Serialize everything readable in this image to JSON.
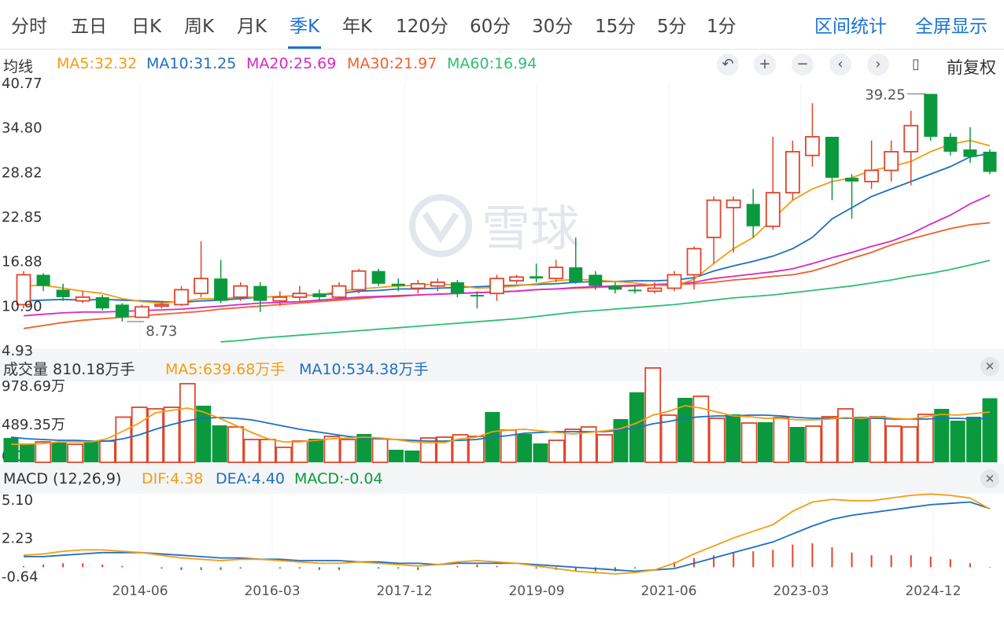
{
  "periods": [
    "分时",
    "五日",
    "日K",
    "周K",
    "月K",
    "季K",
    "年K",
    "120分",
    "60分",
    "30分",
    "15分",
    "5分",
    "1分"
  ],
  "active_period": "季K",
  "tools": {
    "range_stats": "区间统计",
    "fullscreen": "全屏显示"
  },
  "ma_bar": {
    "title": "均线",
    "items": [
      {
        "text": "MA5:32.32",
        "color": "#f39c12"
      },
      {
        "text": "MA10:31.25",
        "color": "#1f6fc1"
      },
      {
        "text": "MA20:25.69",
        "color": "#d62ac6"
      },
      {
        "text": "MA30:21.97",
        "color": "#f0612c"
      },
      {
        "text": "MA60:16.94",
        "color": "#2fbf71"
      }
    ],
    "adjust": "前复权"
  },
  "controls": [
    "undo-icon",
    "plus-icon",
    "minus-icon",
    "chevron-left-icon",
    "chevron-right-icon",
    "candle-icon"
  ],
  "watermark": "雪球",
  "volume_bar": {
    "title": "成交量 810.18万手",
    "ma5": "MA5:639.68万手",
    "ma10": "MA10:534.38万手"
  },
  "macd_bar": {
    "title": "MACD (12,26,9)",
    "dif": "DIF:4.38",
    "dea": "DEA:4.40",
    "macd": "MACD:-0.04"
  },
  "colors": {
    "up": "#e0452a",
    "down": "#0a9a3d",
    "ma5": "#f39c12",
    "ma10": "#1f6fc1",
    "ma20": "#d62ac6",
    "ma30": "#f0612c",
    "ma60": "#2fbf71",
    "dif": "#f39c12",
    "dea": "#1f6fc1"
  },
  "chart_data": {
    "type": "candlestick",
    "x_ticks": [
      "2014-06",
      "2016-03",
      "2017-12",
      "2019-09",
      "2021-06",
      "2023-03",
      "2024-12"
    ],
    "price_axis": {
      "ticks": [
        "40.77",
        "34.80",
        "28.82",
        "22.85",
        "16.88",
        "10.90",
        "4.93"
      ]
    },
    "annotations": {
      "high": "39.25",
      "low": "8.73"
    },
    "candles": [
      {
        "o": 11.0,
        "c": 15.0,
        "h": 15.5,
        "l": 10.5
      },
      {
        "o": 15.0,
        "c": 13.5,
        "h": 15.2,
        "l": 12.8
      },
      {
        "o": 13.0,
        "c": 12.0,
        "h": 13.8,
        "l": 11.5
      },
      {
        "o": 11.5,
        "c": 12.0,
        "h": 12.8,
        "l": 11.2
      },
      {
        "o": 12.0,
        "c": 10.5,
        "h": 12.3,
        "l": 10.2
      },
      {
        "o": 11.0,
        "c": 9.3,
        "h": 11.2,
        "l": 8.73
      },
      {
        "o": 9.3,
        "c": 10.7,
        "h": 11.0,
        "l": 9.2
      },
      {
        "o": 10.8,
        "c": 11.0,
        "h": 11.5,
        "l": 10.5
      },
      {
        "o": 11.0,
        "c": 13.0,
        "h": 13.5,
        "l": 10.8
      },
      {
        "o": 12.5,
        "c": 14.5,
        "h": 19.5,
        "l": 12.0
      },
      {
        "o": 14.5,
        "c": 11.5,
        "h": 17.0,
        "l": 11.2
      },
      {
        "o": 12.0,
        "c": 13.5,
        "h": 14.0,
        "l": 11.5
      },
      {
        "o": 13.5,
        "c": 11.5,
        "h": 14.0,
        "l": 10.0
      },
      {
        "o": 11.5,
        "c": 12.0,
        "h": 12.8,
        "l": 10.8
      },
      {
        "o": 12.0,
        "c": 12.5,
        "h": 13.5,
        "l": 11.5
      },
      {
        "o": 12.5,
        "c": 12.0,
        "h": 13.0,
        "l": 11.5
      },
      {
        "o": 12.0,
        "c": 13.5,
        "h": 14.0,
        "l": 11.8
      },
      {
        "o": 13.0,
        "c": 15.5,
        "h": 15.8,
        "l": 12.5
      },
      {
        "o": 15.5,
        "c": 13.8,
        "h": 15.8,
        "l": 13.5
      },
      {
        "o": 13.8,
        "c": 13.5,
        "h": 14.5,
        "l": 12.8
      },
      {
        "o": 13.2,
        "c": 13.8,
        "h": 14.3,
        "l": 12.5
      },
      {
        "o": 13.5,
        "c": 14.0,
        "h": 14.5,
        "l": 12.8
      },
      {
        "o": 14.0,
        "c": 12.5,
        "h": 14.3,
        "l": 12.0
      },
      {
        "o": 12.3,
        "c": 12.2,
        "h": 12.8,
        "l": 10.5
      },
      {
        "o": 12.5,
        "c": 14.5,
        "h": 15.0,
        "l": 11.5
      },
      {
        "o": 14.2,
        "c": 14.7,
        "h": 15.0,
        "l": 13.8
      },
      {
        "o": 14.8,
        "c": 14.5,
        "h": 16.5,
        "l": 14.0
      },
      {
        "o": 14.5,
        "c": 16.0,
        "h": 17.0,
        "l": 14.0
      },
      {
        "o": 16.0,
        "c": 14.0,
        "h": 20.0,
        "l": 13.8
      },
      {
        "o": 15.0,
        "c": 13.5,
        "h": 15.5,
        "l": 13.0
      },
      {
        "o": 13.5,
        "c": 13.0,
        "h": 14.0,
        "l": 12.5
      },
      {
        "o": 13.0,
        "c": 12.8,
        "h": 13.5,
        "l": 12.5
      },
      {
        "o": 12.8,
        "c": 13.2,
        "h": 14.0,
        "l": 12.5
      },
      {
        "o": 13.2,
        "c": 15.0,
        "h": 15.5,
        "l": 12.8
      },
      {
        "o": 15.0,
        "c": 18.5,
        "h": 18.8,
        "l": 13.0
      },
      {
        "o": 20.0,
        "c": 25.0,
        "h": 25.5,
        "l": 16.5
      },
      {
        "o": 24.0,
        "c": 25.0,
        "h": 25.5,
        "l": 18.0
      },
      {
        "o": 24.5,
        "c": 21.5,
        "h": 26.5,
        "l": 20.0
      },
      {
        "o": 21.5,
        "c": 26.0,
        "h": 33.5,
        "l": 21.0
      },
      {
        "o": 26.0,
        "c": 31.5,
        "h": 33.0,
        "l": 25.0
      },
      {
        "o": 31.0,
        "c": 33.5,
        "h": 38.0,
        "l": 29.5
      },
      {
        "o": 33.5,
        "c": 28.0,
        "h": 33.5,
        "l": 25.0
      },
      {
        "o": 28.0,
        "c": 27.5,
        "h": 28.5,
        "l": 22.5
      },
      {
        "o": 27.5,
        "c": 29.0,
        "h": 33.0,
        "l": 26.5
      },
      {
        "o": 29.0,
        "c": 31.5,
        "h": 33.0,
        "l": 27.5
      },
      {
        "o": 31.5,
        "c": 35.0,
        "h": 37.0,
        "l": 27.0
      },
      {
        "o": 39.25,
        "c": 33.5,
        "h": 39.25,
        "l": 33.0
      },
      {
        "o": 33.5,
        "c": 31.5,
        "h": 34.0,
        "l": 31.0
      },
      {
        "o": 31.8,
        "c": 30.8,
        "h": 34.8,
        "l": 30.0
      },
      {
        "o": 31.5,
        "c": 28.8,
        "h": 31.8,
        "l": 28.5
      }
    ],
    "ma5": [
      13.5,
      13.6,
      13.2,
      12.8,
      12.5,
      11.8,
      11.4,
      11.2,
      11.4,
      11.8,
      11.8,
      12.0,
      12.0,
      12.1,
      12.2,
      12.3,
      12.8,
      13.1,
      13.3,
      13.5,
      13.6,
      13.8,
      13.6,
      13.2,
      13.3,
      13.5,
      13.8,
      14.2,
      14.4,
      14.3,
      14.1,
      13.9,
      13.6,
      13.5,
      14.4,
      16.5,
      18.5,
      20.0,
      22.5,
      25.0,
      26.5,
      27.5,
      28.0,
      29.0,
      29.5,
      30.2,
      31.5,
      32.5,
      33.0,
      32.3
    ],
    "ma10": [
      11.5,
      11.6,
      11.7,
      11.6,
      11.7,
      11.6,
      11.5,
      11.4,
      11.3,
      11.5,
      11.6,
      11.8,
      12.0,
      12.1,
      12.2,
      12.3,
      12.5,
      12.8,
      12.9,
      13.1,
      13.1,
      13.2,
      13.3,
      13.4,
      13.5,
      13.6,
      13.7,
      13.8,
      14.0,
      14.1,
      14.1,
      14.2,
      14.2,
      14.3,
      14.6,
      15.5,
      16.2,
      16.8,
      17.5,
      18.5,
      20.0,
      22.5,
      24.0,
      25.5,
      26.5,
      27.5,
      28.5,
      29.5,
      30.8,
      31.25
    ],
    "ma20": [
      9.5,
      9.7,
      9.9,
      10.0,
      10.0,
      10.1,
      10.2,
      10.3,
      10.4,
      10.6,
      10.8,
      11.0,
      11.2,
      11.3,
      11.4,
      11.6,
      11.8,
      12.0,
      12.1,
      12.2,
      12.3,
      12.4,
      12.5,
      12.6,
      12.7,
      12.8,
      13.0,
      13.1,
      13.3,
      13.4,
      13.5,
      13.6,
      13.7,
      13.8,
      14.0,
      14.5,
      14.8,
      15.1,
      15.4,
      15.8,
      16.5,
      17.3,
      18.0,
      18.8,
      19.5,
      20.5,
      21.8,
      23.0,
      24.5,
      25.69
    ],
    "ma30": [
      7.8,
      8.2,
      8.6,
      8.9,
      9.1,
      9.3,
      9.5,
      9.7,
      9.9,
      10.1,
      10.4,
      10.6,
      10.8,
      11.0,
      11.2,
      11.4,
      11.6,
      11.8,
      12.0,
      12.1,
      12.3,
      12.4,
      12.5,
      12.6,
      12.7,
      12.8,
      13.0,
      13.1,
      13.2,
      13.3,
      13.4,
      13.5,
      13.6,
      13.7,
      13.8,
      14.0,
      14.3,
      14.5,
      14.8,
      15.0,
      15.5,
      16.3,
      17.2,
      18.0,
      19.0,
      19.8,
      20.5,
      21.2,
      21.7,
      21.97
    ],
    "ma60": [
      null,
      null,
      null,
      null,
      null,
      null,
      null,
      null,
      null,
      null,
      6.0,
      6.2,
      6.5,
      6.7,
      6.9,
      7.1,
      7.3,
      7.5,
      7.7,
      7.9,
      8.1,
      8.3,
      8.5,
      8.7,
      8.9,
      9.1,
      9.4,
      9.7,
      10.0,
      10.2,
      10.4,
      10.6,
      10.8,
      11.0,
      11.3,
      11.6,
      11.9,
      12.1,
      12.3,
      12.6,
      12.9,
      13.2,
      13.5,
      13.9,
      14.3,
      14.8,
      15.2,
      15.7,
      16.3,
      16.94
    ],
    "volume": {
      "ticks": [
        "978.69万",
        "489.35万",
        "0.00"
      ],
      "values": [
        310,
        240,
        260,
        250,
        230,
        260,
        270,
        575,
        700,
        680,
        700,
        1000,
        720,
        470,
        450,
        290,
        290,
        190,
        270,
        300,
        330,
        290,
        360,
        300,
        160,
        150,
        310,
        320,
        350,
        330,
        640,
        410,
        360,
        240,
        280,
        420,
        450,
        350,
        550,
        890,
        1200,
        600,
        820,
        840,
        560,
        610,
        500,
        510,
        570,
        450,
        460,
        580,
        680,
        580,
        580,
        460,
        450,
        610,
        680,
        530,
        580,
        815
      ],
      "direction": [
        "d",
        "d",
        "u",
        "d",
        "u",
        "d",
        "u",
        "u",
        "u",
        "u",
        "u",
        "u",
        "d",
        "d",
        "u",
        "u",
        "u",
        "u",
        "u",
        "d",
        "u",
        "u",
        "d",
        "u",
        "d",
        "d",
        "u",
        "u",
        "u",
        "u",
        "d",
        "u",
        "d",
        "d",
        "u",
        "u",
        "u",
        "u",
        "d",
        "d",
        "u",
        "u",
        "d",
        "u",
        "u",
        "d",
        "u",
        "d",
        "u",
        "d",
        "u",
        "u",
        "u",
        "d",
        "u",
        "u",
        "u",
        "u",
        "d",
        "d",
        "d",
        "d"
      ],
      "ma5": [
        230,
        230,
        240,
        260,
        260,
        260,
        300,
        400,
        500,
        630,
        660,
        690,
        640,
        560,
        470,
        380,
        300,
        260,
        260,
        280,
        300,
        310,
        320,
        310,
        290,
        260,
        250,
        250,
        300,
        320,
        390,
        410,
        420,
        400,
        380,
        360,
        380,
        400,
        430,
        500,
        600,
        650,
        720,
        690,
        640,
        590,
        580,
        560,
        560,
        540,
        540,
        550,
        570,
        560,
        580,
        560,
        550,
        580,
        610,
        600,
        620,
        640
      ],
      "ma10": [
        320,
        300,
        290,
        280,
        280,
        270,
        270,
        300,
        350,
        420,
        480,
        530,
        560,
        570,
        560,
        540,
        500,
        460,
        420,
        390,
        360,
        330,
        310,
        300,
        290,
        280,
        270,
        270,
        280,
        290,
        320,
        340,
        370,
        380,
        390,
        390,
        390,
        390,
        410,
        440,
        490,
        520,
        560,
        580,
        590,
        590,
        600,
        600,
        590,
        570,
        560,
        560,
        560,
        560,
        560,
        550,
        550,
        550,
        560,
        560,
        550,
        560
      ]
    },
    "macd": {
      "ticks": [
        "5.10",
        "2.23",
        "-0.64"
      ],
      "dif": [
        0.9,
        1.0,
        1.2,
        1.3,
        1.3,
        1.2,
        1.1,
        0.9,
        0.7,
        0.6,
        0.5,
        0.6,
        0.6,
        0.5,
        0.4,
        0.3,
        0.3,
        0.4,
        0.3,
        0.2,
        0.1,
        0.2,
        0.4,
        0.5,
        0.4,
        0.3,
        0.1,
        -0.1,
        -0.3,
        -0.4,
        -0.5,
        -0.4,
        -0.2,
        0.3,
        1.0,
        1.6,
        2.2,
        2.7,
        3.2,
        4.2,
        4.9,
        5.1,
        5.0,
        5.0,
        5.2,
        5.4,
        5.5,
        5.4,
        5.2,
        4.38
      ],
      "dea": [
        0.8,
        0.8,
        0.9,
        1.0,
        1.1,
        1.1,
        1.1,
        1.0,
        0.9,
        0.8,
        0.7,
        0.7,
        0.6,
        0.6,
        0.5,
        0.5,
        0.5,
        0.4,
        0.4,
        0.3,
        0.3,
        0.2,
        0.3,
        0.3,
        0.3,
        0.3,
        0.2,
        0.1,
        0.0,
        -0.1,
        -0.2,
        -0.3,
        -0.2,
        -0.1,
        0.3,
        0.7,
        1.1,
        1.5,
        1.9,
        2.5,
        3.1,
        3.6,
        3.9,
        4.1,
        4.3,
        4.5,
        4.7,
        4.8,
        4.9,
        4.4
      ],
      "hist": [
        0.1,
        0.2,
        0.3,
        0.3,
        0.2,
        0.1,
        0.0,
        -0.1,
        -0.2,
        -0.2,
        -0.2,
        -0.1,
        0.0,
        -0.1,
        -0.1,
        -0.2,
        -0.2,
        0.0,
        -0.1,
        -0.1,
        -0.2,
        0.0,
        0.1,
        0.2,
        0.1,
        0.0,
        -0.1,
        -0.2,
        -0.3,
        -0.3,
        -0.3,
        -0.1,
        0.0,
        0.4,
        0.7,
        0.9,
        1.1,
        1.2,
        1.3,
        1.7,
        1.8,
        1.5,
        1.1,
        0.9,
        0.9,
        0.9,
        0.8,
        0.6,
        0.3,
        -0.04
      ]
    }
  }
}
